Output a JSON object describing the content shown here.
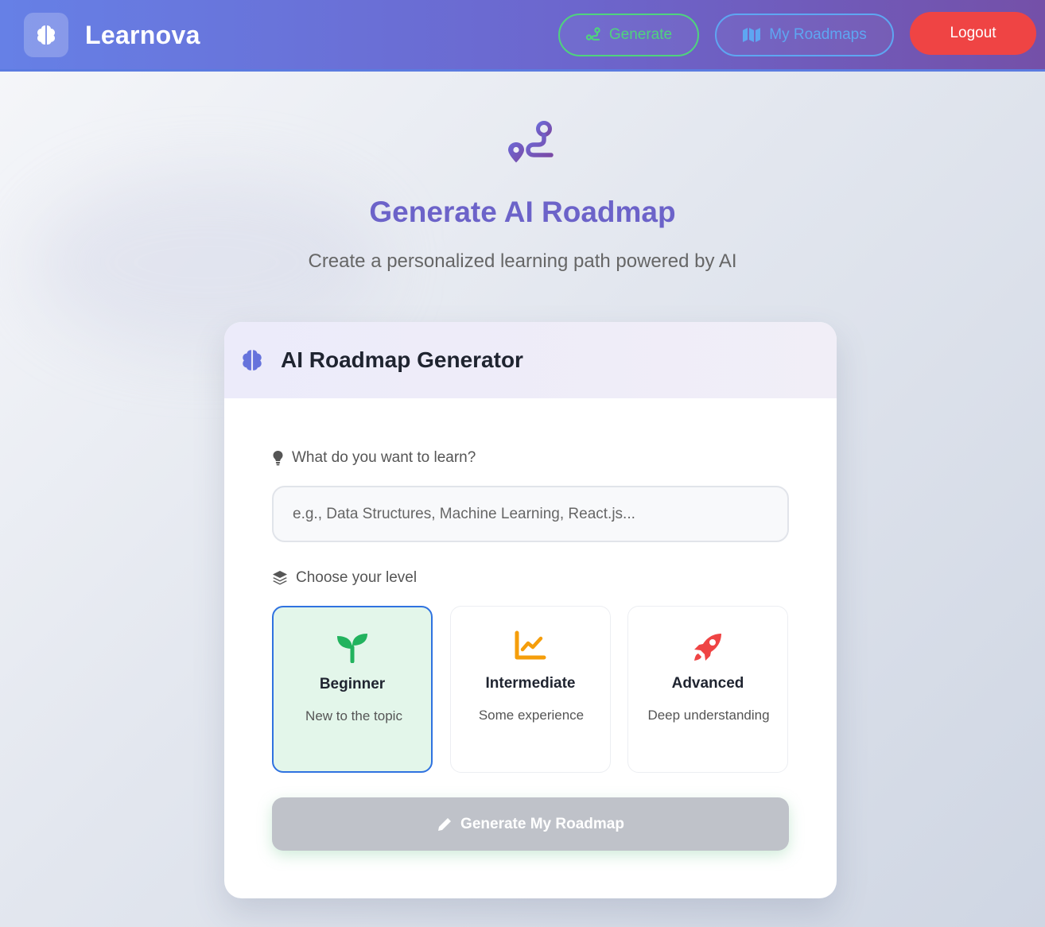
{
  "app": {
    "name": "Learnova"
  },
  "nav": {
    "generate_label": "Generate",
    "roadmaps_label": "My Roadmaps",
    "logout_label": "Logout"
  },
  "hero": {
    "title": "Generate AI Roadmap",
    "subtitle": "Create a personalized learning path powered by AI"
  },
  "card": {
    "title": "AI Roadmap Generator",
    "topic_label": "What do you want to learn?",
    "topic_placeholder": "e.g., Data Structures, Machine Learning, React.js...",
    "topic_value": "",
    "level_label": "Choose your level",
    "levels": [
      {
        "name": "Beginner",
        "desc": "New to the topic",
        "icon": "seedling-icon",
        "selected": true
      },
      {
        "name": "Intermediate",
        "desc": "Some experience",
        "icon": "chart-line-icon",
        "selected": false
      },
      {
        "name": "Advanced",
        "desc": "Deep understanding",
        "icon": "rocket-icon",
        "selected": false
      }
    ],
    "submit_label": "Generate My Roadmap",
    "submit_enabled": false
  },
  "colors": {
    "accent": "#6c63c9",
    "generate_border": "#4fd37d",
    "roadmaps_border": "#5ea6f2",
    "logout_bg": "#ef4444",
    "selected_border": "#2f72e0",
    "selected_bg": "#e3f6ea"
  }
}
